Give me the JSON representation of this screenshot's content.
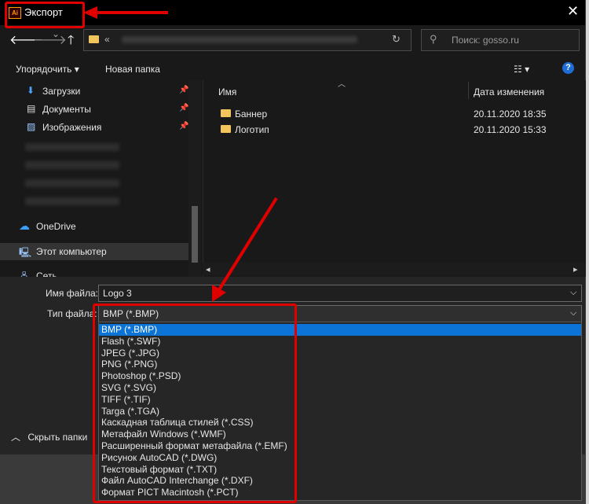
{
  "window": {
    "title": "Экспорт",
    "app_icon_text": "Ai",
    "close": "✕"
  },
  "nav": {
    "back": "🡐",
    "forward": "🡒",
    "dropdown": "⌄",
    "up": "🡑",
    "address_prefix": "«",
    "refresh": "↻",
    "search_placeholder": "Поиск: gosso.ru",
    "search_icon": "⚲"
  },
  "toolbar": {
    "organize": "Упорядочить ▾",
    "new_folder": "Новая папка",
    "view": "☷ ▾",
    "help": "?"
  },
  "sidebar": {
    "items": [
      {
        "label": "Загрузки",
        "icon": "download-icon",
        "glyph": "⬇",
        "pinned": true
      },
      {
        "label": "Документы",
        "icon": "document-icon",
        "glyph": "▤",
        "pinned": true
      },
      {
        "label": "Изображения",
        "icon": "pictures-icon",
        "glyph": "▨",
        "pinned": true
      },
      {
        "label": "OneDrive",
        "icon": "cloud-icon",
        "glyph": "☁",
        "pinned": false
      },
      {
        "label": "Этот компьютер",
        "icon": "computer-icon",
        "glyph": "🖳",
        "pinned": false
      },
      {
        "label": "Сеть",
        "icon": "network-icon",
        "glyph": "🖧",
        "pinned": false
      }
    ],
    "pin_glyph": "📌"
  },
  "columns": {
    "name": "Имя",
    "date": "Дата изменения"
  },
  "files": [
    {
      "name": "Баннер",
      "date": "20.11.2020 18:35"
    },
    {
      "name": "Логотип",
      "date": "20.11.2020 15:33"
    }
  ],
  "form": {
    "filename_label": "Имя файла:",
    "filename_value": "Logo 3",
    "type_label": "Тип файла:",
    "type_value": "BMP (*.BMP)"
  },
  "file_types": [
    "BMP (*.BMP)",
    "Flash (*.SWF)",
    "JPEG (*.JPG)",
    "PNG (*.PNG)",
    "Photoshop (*.PSD)",
    "SVG (*.SVG)",
    "TIFF (*.TIF)",
    "Targa (*.TGA)",
    "Каскадная таблица стилей (*.CSS)",
    "Метафайл Windows (*.WMF)",
    "Расширенный формат метафайла (*.EMF)",
    "Рисунок AutoCAD (*.DWG)",
    "Текстовый формат (*.TXT)",
    "Файл AutoCAD Interchange (*.DXF)",
    "Формат PICT Macintosh (*.PCT)"
  ],
  "selected_type_index": 0,
  "footer": {
    "hide_folders": "Скрыть папки"
  },
  "colors": {
    "accent": "#0b74d6",
    "annotation": "#e00000",
    "folder": "#f2c55c"
  }
}
